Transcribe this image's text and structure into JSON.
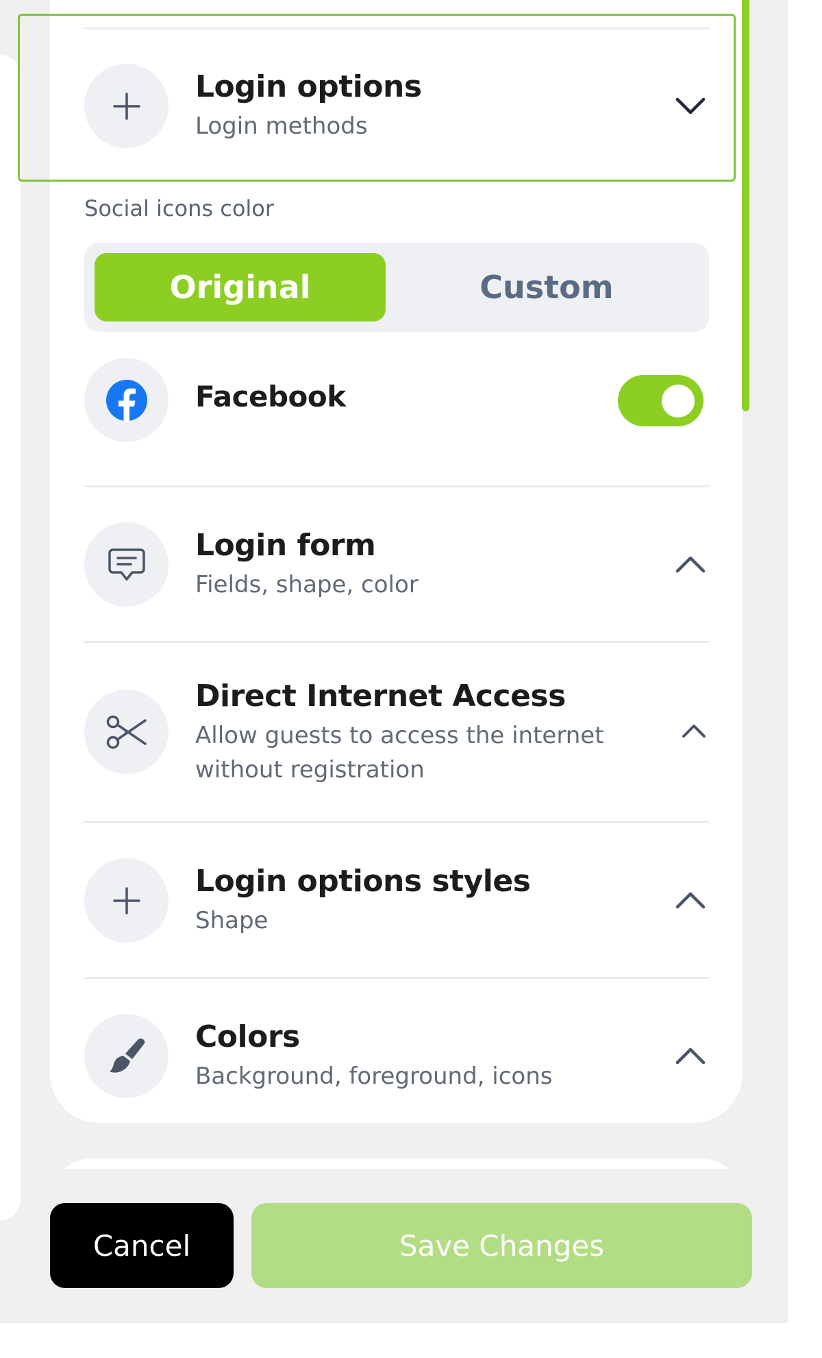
{
  "colors": {
    "accent": "#8ccf22",
    "accent_disabled": "#b3dd84",
    "highlight_border": "#7fc43a",
    "icon_bg": "#eef0f3",
    "icon_stroke": "#4a5568",
    "facebook_blue": "#1877f2"
  },
  "sections": {
    "login_options": {
      "title": "Login options",
      "subtitle": "Login methods",
      "icon": "plus-icon",
      "state": "expanded"
    },
    "login_form": {
      "title": "Login form",
      "subtitle": "Fields, shape, color",
      "icon": "chat-icon",
      "state": "collapsed"
    },
    "direct_access": {
      "title": "Direct Internet Access",
      "subtitle_line1": "Allow guests to access the internet",
      "subtitle_line2": "without registration",
      "icon": "scissors-icon",
      "state": "collapsed"
    },
    "login_styles": {
      "title": "Login options styles",
      "subtitle": "Shape",
      "icon": "plus-icon",
      "state": "collapsed"
    },
    "colors": {
      "title": "Colors",
      "subtitle": "Background, foreground, icons",
      "icon": "brush-icon",
      "state": "collapsed"
    }
  },
  "social_icons": {
    "label": "Social icons color",
    "options": [
      "Original",
      "Custom"
    ],
    "selected": "Original"
  },
  "providers": [
    {
      "name": "Facebook",
      "icon": "facebook-icon",
      "enabled": true
    }
  ],
  "footer": {
    "cancel_label": "Cancel",
    "save_label": "Save Changes"
  }
}
